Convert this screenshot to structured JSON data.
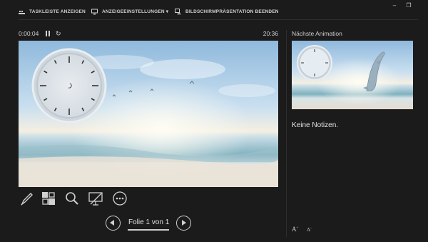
{
  "toolbar": {
    "taskbar_label": "TASKLEISTE ANZEIGEN",
    "display_settings_label": "ANZEIGEEINSTELLUNGEN ▾",
    "end_slideshow_label": "BILDSCHIRMPRÄSENTATION BEENDEN"
  },
  "timer": {
    "elapsed": "0:00:04",
    "clock": "20:36"
  },
  "next_panel": {
    "label": "Nächste Animation",
    "notes": "Keine Notizen."
  },
  "navigation": {
    "slide_counter": "Folie 1 von 1"
  },
  "tools": [
    "pen-tool",
    "see-all-slides",
    "zoom",
    "black-screen",
    "more-options"
  ],
  "colors": {
    "background": "#1b1b1b",
    "text": "#d6d6d6",
    "sky": "#a9cbe3",
    "sea": "#7aa8b8",
    "sand": "#e6dcd0"
  }
}
